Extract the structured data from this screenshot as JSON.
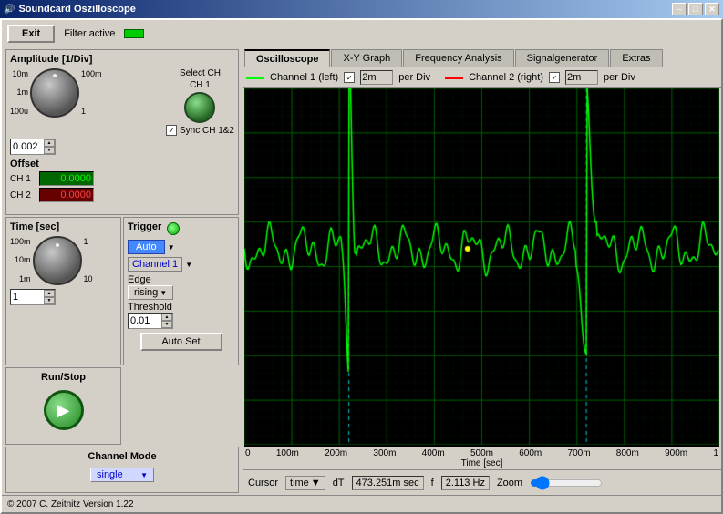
{
  "titleBar": {
    "title": "Soundcard Oszilloscope",
    "minBtn": "─",
    "maxBtn": "□",
    "closeBtn": "✕"
  },
  "topBar": {
    "exitLabel": "Exit",
    "filterActiveLabel": "Filter active"
  },
  "tabs": [
    {
      "id": "oscilloscope",
      "label": "Oscilloscope",
      "active": true
    },
    {
      "id": "xy-graph",
      "label": "X-Y Graph",
      "active": false
    },
    {
      "id": "frequency-analysis",
      "label": "Frequency Analysis",
      "active": false
    },
    {
      "id": "signalgenerator",
      "label": "Signalgenerator",
      "active": false
    },
    {
      "id": "extras",
      "label": "Extras",
      "active": false
    }
  ],
  "scopeToolbar": {
    "ch1Label": "Channel 1 (left)",
    "ch1PerDiv": "2m",
    "ch1PerDivSuffix": "per Div",
    "ch2Label": "Channel 2 (right)",
    "ch2PerDiv": "2m",
    "ch2PerDivSuffix": "per Div"
  },
  "amplitude": {
    "title": "Amplitude [1/Div]",
    "knobLabels": {
      "topLeft": "10m",
      "topRight": "100m",
      "left": "1m",
      "right": "1",
      "bottomLeft": "100u"
    },
    "spinboxValue": "0.002",
    "selectCH": "Select CH",
    "ch1Label": "CH 1",
    "syncLabel": "Sync CH 1&2",
    "offsetLabel": "Offset",
    "ch1OffsetLabel": "CH 1",
    "ch2OffsetLabel": "CH 2",
    "ch1OffsetValue": "0.0000",
    "ch2OffsetValue": "0.0000"
  },
  "time": {
    "title": "Time [sec]",
    "knobLabels": {
      "topLeft": "100m",
      "topRight": "1",
      "left": "10m",
      "right": "10",
      "bottomLeft": "1m"
    },
    "spinboxValue": "1"
  },
  "trigger": {
    "title": "Trigger",
    "modeLabel": "Auto",
    "channelLabel": "Channel 1",
    "edgeLabel": "Edge",
    "edgeValue": "rising",
    "thresholdLabel": "Threshold",
    "thresholdValue": "0.01",
    "autoSetLabel": "Auto Set"
  },
  "runStop": {
    "title": "Run/Stop"
  },
  "channelMode": {
    "title": "Channel Mode",
    "value": "single"
  },
  "cursor": {
    "label": "Cursor",
    "typeLabel": "time",
    "dtLabel": "dT",
    "dtValue": "473.251m",
    "dtUnit": "sec",
    "fLabel": "f",
    "fValue": "2.113",
    "fUnit": "Hz",
    "zoomLabel": "Zoom"
  },
  "footer": {
    "text": "© 2007  C. Zeitnitz Version 1.22"
  },
  "xAxis": {
    "label": "Time [sec]",
    "ticks": [
      "0",
      "100m",
      "200m",
      "300m",
      "400m",
      "500m",
      "600m",
      "700m",
      "800m",
      "900m",
      "1"
    ]
  }
}
